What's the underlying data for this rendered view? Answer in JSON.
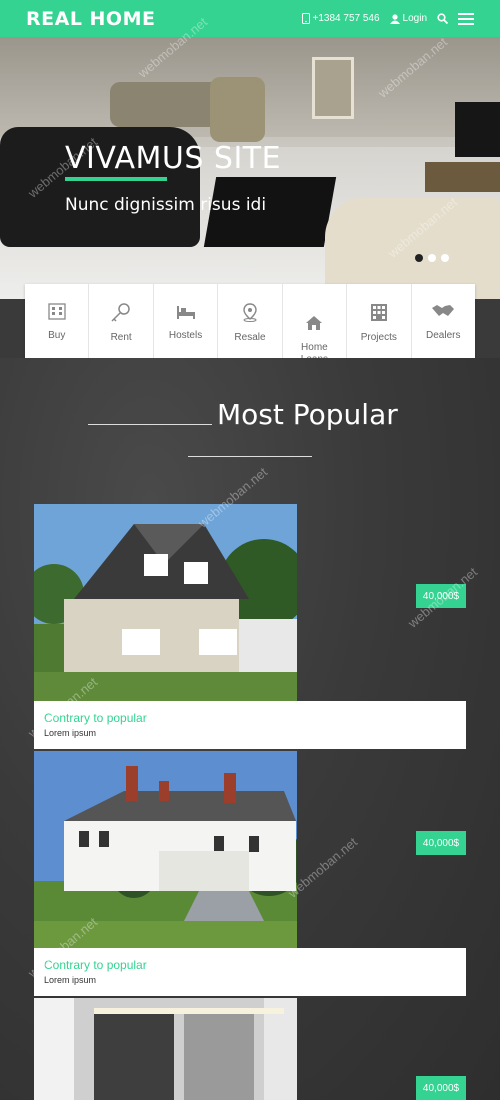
{
  "header": {
    "logo": "REAL HOME",
    "phone": "+1384 757 546",
    "login_label": "Login"
  },
  "hero": {
    "title": "VIVAMUS SITE",
    "subtitle": "Nunc dignissim risus idi",
    "slides": 3,
    "active_slide": 1
  },
  "categories": [
    {
      "label": "Buy",
      "icon": "building-icon"
    },
    {
      "label": "Rent",
      "icon": "key-icon"
    },
    {
      "label": "Hostels",
      "icon": "bed-icon"
    },
    {
      "label": "Resale",
      "icon": "map-pin-icon"
    },
    {
      "label": "Home\nLoans",
      "icon": "house-icon"
    },
    {
      "label": "Projects",
      "icon": "city-icon"
    },
    {
      "label": "Dealers",
      "icon": "handshake-icon"
    }
  ],
  "section": {
    "title": "Most Popular"
  },
  "listings": [
    {
      "title": "Contrary to popular",
      "subtitle": "Lorem ipsum",
      "price": "40,000$"
    },
    {
      "title": "Contrary to popular",
      "subtitle": "Lorem ipsum",
      "price": "40,000$"
    },
    {
      "title": "",
      "subtitle": "",
      "price": "40,000$"
    }
  ],
  "watermark": "webmoban.net",
  "colors": {
    "accent": "#34d391"
  }
}
